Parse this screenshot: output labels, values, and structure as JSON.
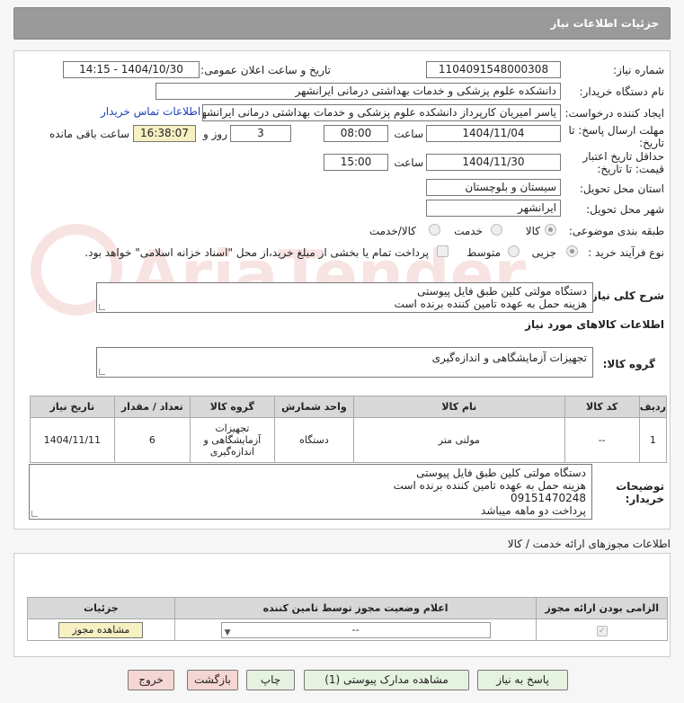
{
  "header": {
    "title": "جزئیات اطلاعات نیاز"
  },
  "fields": {
    "need_number_label": "شماره نیاز:",
    "need_number": "1104091548000308",
    "announce_label": "تاریخ و ساعت اعلان عمومی:",
    "announce_value": "1404/10/30 - 14:15",
    "buyer_org_label": "نام دستگاه خریدار:",
    "buyer_org": "دانشکده علوم پزشکی و خدمات بهداشتی درمانی ایرانشهر",
    "creator_label": "ایجاد کننده درخواست:",
    "creator": "یاسر امیریان کارپرداز دانشکده علوم پزشکی و خدمات بهداشتی درمانی ایرانشهر",
    "contact_link": "اطلاعات تماس خریدار",
    "deadline_label_1": "مهلت ارسال پاسخ: تا",
    "deadline_label_2": "تاریخ:",
    "deadline_date": "1404/11/04",
    "time_label": "ساعت",
    "deadline_time": "08:00",
    "days_value": "3",
    "days_label": "روز و",
    "remaining_time": "16:38:07",
    "remaining_label": "ساعت باقی مانده",
    "validity_label_1": "حداقل تاریخ اعتبار",
    "validity_label_2": "قیمت: تا تاریخ:",
    "validity_date": "1404/11/30",
    "validity_time": "15:00",
    "province_label": "استان محل تحویل:",
    "province": "سیستان و بلوچستان",
    "city_label": "شهر محل تحویل:",
    "city": "ایرانشهر",
    "category_label": "طبقه بندی موضوعی:",
    "cat_goods": "کالا",
    "cat_service": "خدمت",
    "cat_goods_service": "کالا/خدمت",
    "process_label": "نوع فرآیند خرید :",
    "proc_minor": "جزیی",
    "proc_medium": "متوسط",
    "payment_note": "پرداخت تمام یا بخشی از مبلغ خرید،از محل \"اسناد خزانه اسلامی\" خواهد بود.",
    "summary_label": "شرح کلی نیاز:",
    "summary_line1": "دستگاه مولتی کلین طبق فایل پیوستی",
    "summary_line2": "هزینه حمل به عهده تامین کننده برنده است",
    "goods_info_title": "اطلاعات کالاهای مورد نیاز",
    "goods_group_label": "گروه کالا:",
    "goods_group": "تجهیزات آزمایشگاهی و اندازه‌گیری",
    "buyer_notes_label_1": "توضیحات",
    "buyer_notes_label_2": "خریدار:",
    "notes_line1": "دستگاه مولتی کلین طبق فایل پیوستی",
    "notes_line2": "هزینه حمل به عهده تامین کننده برنده است",
    "notes_line3": "09151470248",
    "notes_line4": "پرداخت دو ماهه میباشد"
  },
  "table": {
    "headers": [
      "ردیف",
      "کد کالا",
      "نام کالا",
      "واحد شمارش",
      "گروه کالا",
      "تعداد / مقدار",
      "تاریخ نیاز"
    ],
    "row": {
      "index": "1",
      "code": "--",
      "name": "مولتی متر",
      "unit": "دستگاه",
      "group": "تجهیزات آزمایشگاهی و اندازه‌گیری",
      "qty": "6",
      "date": "1404/11/11"
    }
  },
  "license": {
    "title": "اطلاعات مجوزهای ارائه خدمت / کالا",
    "col_required": "الزامی بودن ارائه مجوز",
    "col_status": "اعلام وضعیت مجوز توسط تامین کننده",
    "col_details": "جزئیات",
    "select_value": "--",
    "view_button": "مشاهده مجوز"
  },
  "buttons": {
    "reply": "پاسخ به نیاز",
    "attachments": "مشاهده مدارک پیوستی (1)",
    "print": "چاپ",
    "back": "بازگشت",
    "exit": "خروج"
  },
  "watermark": "AriaTender.net"
}
